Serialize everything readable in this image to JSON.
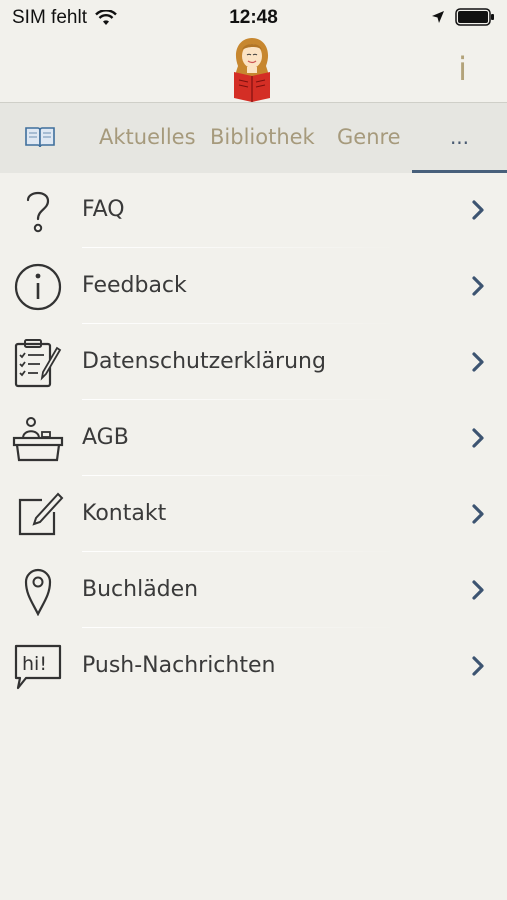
{
  "status": {
    "carrier": "SIM fehlt",
    "time": "12:48"
  },
  "header": {
    "info_label": "i"
  },
  "tabs": [
    {
      "label": "📖",
      "icon": "book-icon"
    },
    {
      "label": "Aktuelles"
    },
    {
      "label": "Bibliothek"
    },
    {
      "label": "Genre"
    },
    {
      "label": "...",
      "active": true
    }
  ],
  "menu": {
    "items": [
      {
        "label": "FAQ",
        "icon": "question-icon"
      },
      {
        "label": "Feedback",
        "icon": "info-circle-icon"
      },
      {
        "label": "Datenschutzerklärung",
        "icon": "clipboard-icon"
      },
      {
        "label": "AGB",
        "icon": "desk-icon"
      },
      {
        "label": "Kontakt",
        "icon": "edit-icon"
      },
      {
        "label": "Buchläden",
        "icon": "location-pin-icon"
      },
      {
        "label": "Push-Nachrichten",
        "icon": "hi-speech-bubble-icon"
      }
    ]
  },
  "colors": {
    "background": "#f2f1ec",
    "tab_bar": "#e6e6e1",
    "tab_inactive": "#a69a7c",
    "tab_active": "#48607b",
    "chevron": "#3d5471"
  }
}
